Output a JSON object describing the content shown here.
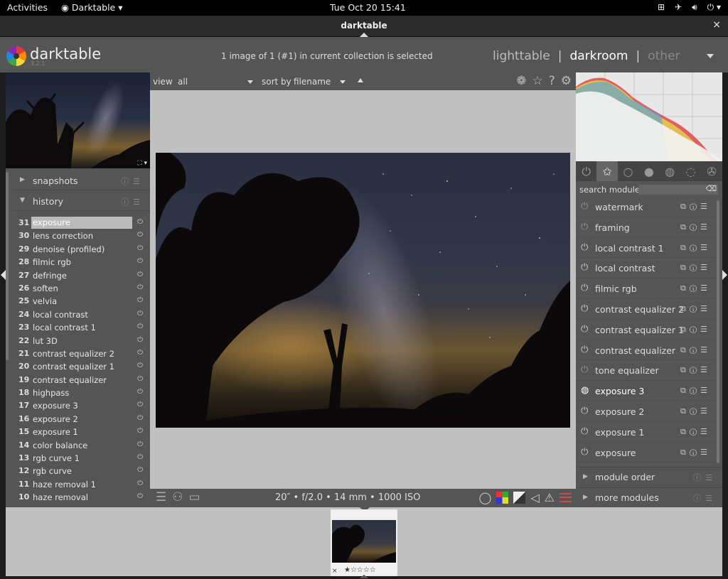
{
  "system": {
    "activities": "Activities",
    "app_menu": "Darktable",
    "clock": "Tue Oct 20  15:41"
  },
  "window": {
    "title": "darktable",
    "close": "×"
  },
  "header": {
    "app_name": "darktable",
    "version": "3.2.1",
    "selection_info": "1 image of 1 (#1) in current collection is selected",
    "views": {
      "lighttable": "lighttable",
      "darkroom": "darkroom",
      "other": "other",
      "sep": "|"
    }
  },
  "left_panel": {
    "snapshots": "snapshots",
    "history": "history",
    "history_items": [
      {
        "num": "31",
        "name": "exposure",
        "selected": true
      },
      {
        "num": "30",
        "name": "lens correction"
      },
      {
        "num": "29",
        "name": "denoise (profiled)"
      },
      {
        "num": "28",
        "name": "filmic rgb"
      },
      {
        "num": "27",
        "name": "defringe"
      },
      {
        "num": "26",
        "name": "soften"
      },
      {
        "num": "25",
        "name": "velvia"
      },
      {
        "num": "24",
        "name": "local contrast"
      },
      {
        "num": "23",
        "name": "local contrast 1"
      },
      {
        "num": "22",
        "name": "lut 3D"
      },
      {
        "num": "21",
        "name": "contrast equalizer 2"
      },
      {
        "num": "20",
        "name": "contrast equalizer 1"
      },
      {
        "num": "19",
        "name": "contrast equalizer"
      },
      {
        "num": "18",
        "name": "highpass"
      },
      {
        "num": "17",
        "name": "exposure 3"
      },
      {
        "num": "16",
        "name": "exposure 2"
      },
      {
        "num": "15",
        "name": "exposure 1"
      },
      {
        "num": "14",
        "name": "color balance"
      },
      {
        "num": "13",
        "name": "rgb curve 1"
      },
      {
        "num": "12",
        "name": "rgb curve"
      },
      {
        "num": "11",
        "name": "haze removal 1"
      },
      {
        "num": "10",
        "name": "haze removal"
      }
    ]
  },
  "center": {
    "view_label": "view",
    "view_value": "all",
    "sort_label": "sort by",
    "sort_value": "filename",
    "exif": "20″ • f/2.0 • 14 mm • 1000 ISO"
  },
  "right_panel": {
    "search_label": "search module",
    "modules": [
      {
        "name": "watermark",
        "state": "off"
      },
      {
        "name": "framing",
        "state": "off"
      },
      {
        "name": "local contrast 1",
        "state": "on"
      },
      {
        "name": "local contrast",
        "state": "on"
      },
      {
        "name": "filmic rgb",
        "state": "on"
      },
      {
        "name": "contrast equalizer 2",
        "state": "on"
      },
      {
        "name": "contrast equalizer 1",
        "state": "on"
      },
      {
        "name": "contrast equalizer",
        "state": "on"
      },
      {
        "name": "tone equalizer",
        "state": "off"
      },
      {
        "name": "exposure 3",
        "state": "focused"
      },
      {
        "name": "exposure 2",
        "state": "on"
      },
      {
        "name": "exposure 1",
        "state": "on"
      },
      {
        "name": "exposure",
        "state": "on"
      }
    ],
    "module_order": "module order",
    "more_modules": "more modules"
  },
  "filmstrip": {
    "reject": "×",
    "stars": "★☆☆☆☆"
  },
  "colors": {
    "panel": "#555555",
    "background": "#c0c0c0",
    "accent_selected": "#bbbbbb"
  }
}
